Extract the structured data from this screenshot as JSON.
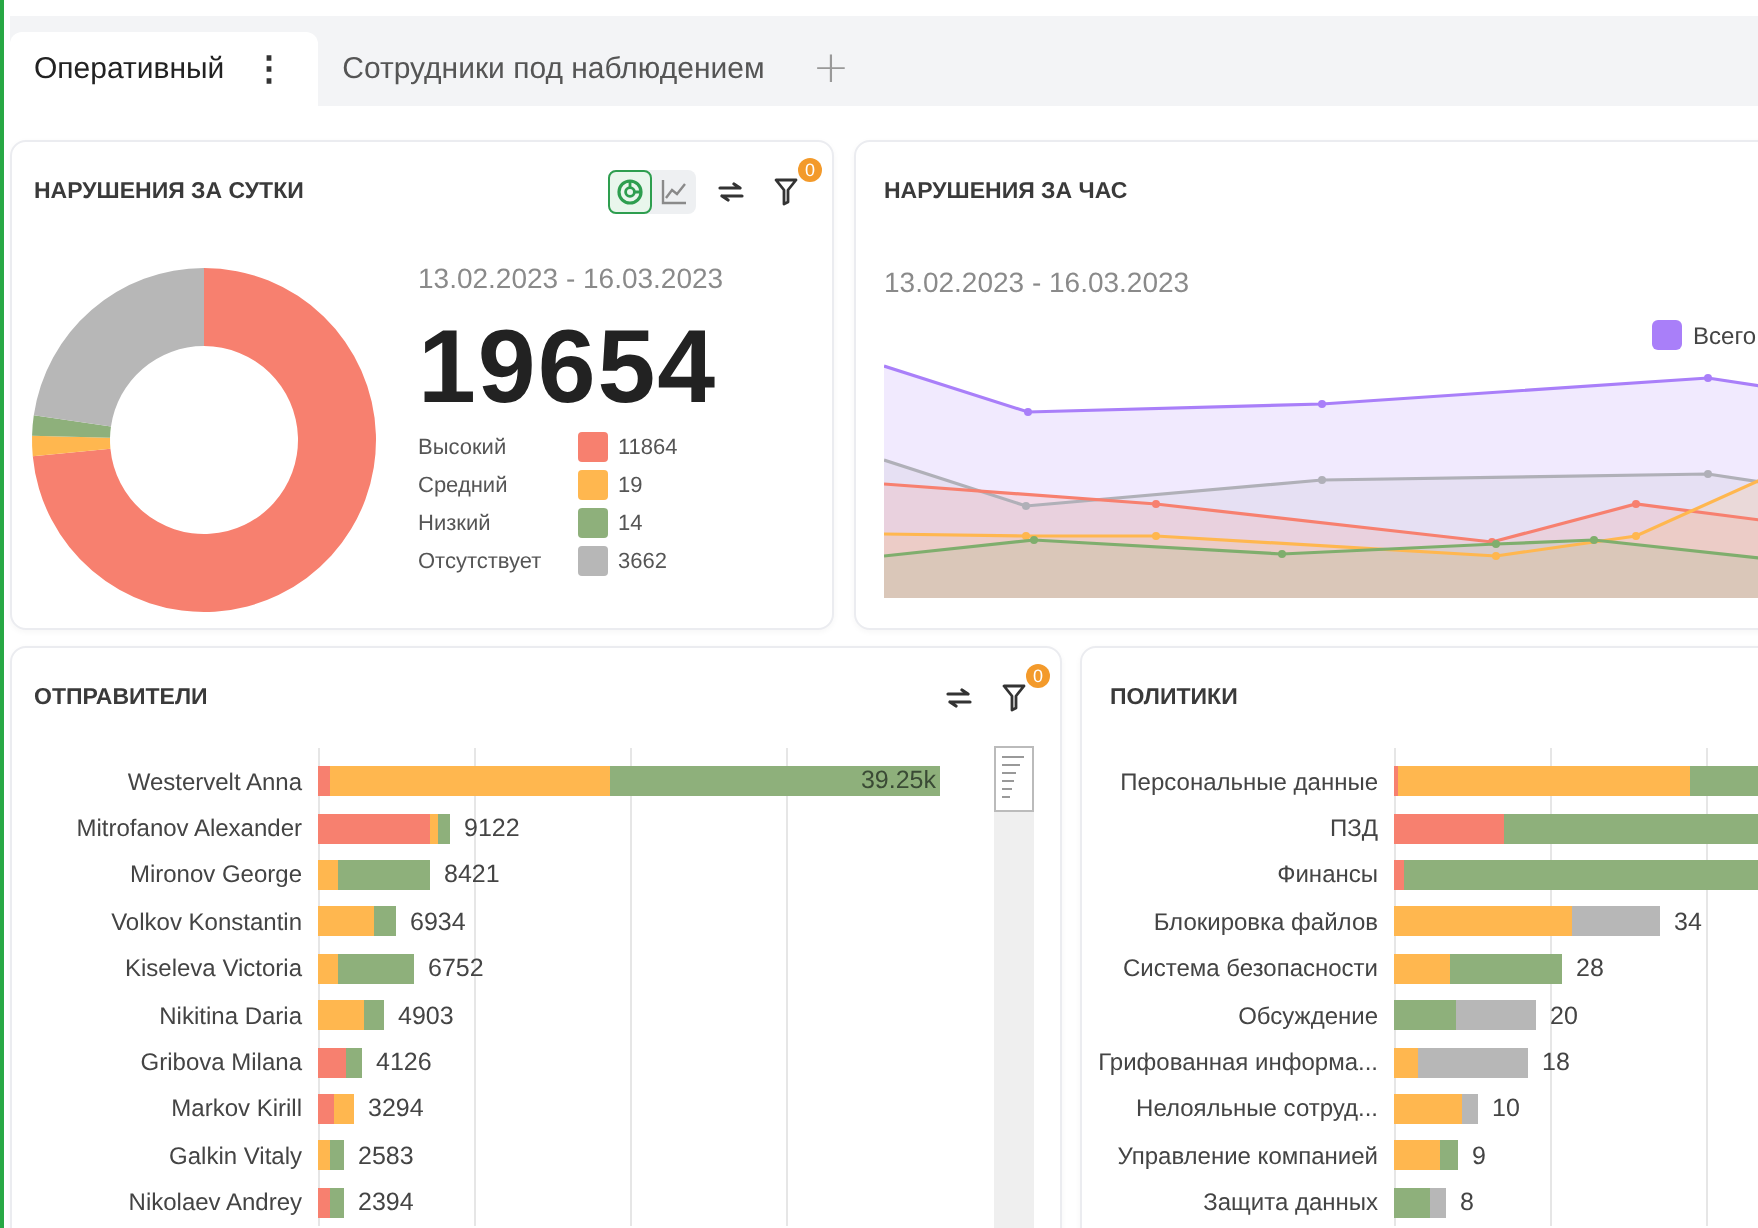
{
  "tabs": [
    {
      "label": "Оперативный",
      "menu": "⋮",
      "selected": true
    },
    {
      "label": "Сотрудники под наблюдением",
      "selected": false
    }
  ],
  "add_tab": "+",
  "daily": {
    "title": "НАРУШЕНИЯ ЗА СУТКИ",
    "view_toggles": [
      {
        "kind": "donut",
        "selected": true
      },
      {
        "kind": "line",
        "selected": false
      }
    ],
    "filter_badge": "0",
    "date_range": "13.02.2023 - 16.03.2023",
    "total": "19654",
    "legend": [
      {
        "label": "Высокий",
        "value": "11864",
        "color": "#f7806f"
      },
      {
        "label": "Средний",
        "value": "19",
        "color": "#ffb74f"
      },
      {
        "label": "Низкий",
        "value": "14",
        "color": "#8eb07b"
      },
      {
        "label": "Отсутствует",
        "value": "3662",
        "color": "#b7b7b7"
      }
    ]
  },
  "hourly": {
    "title": "НАРУШЕНИЯ ЗА ЧАС",
    "date_range": "13.02.2023 - 16.03.2023",
    "legend": [
      {
        "label": "Всего",
        "color": "#a97ff9"
      }
    ]
  },
  "senders": {
    "title": "ОТПРАВИТЕЛИ",
    "filter_badge": "0",
    "rows": [
      {
        "name": "Westervelt Anna",
        "value": "39.25k"
      },
      {
        "name": "Mitrofanov Alexander",
        "value": "9122"
      },
      {
        "name": "Mironov George",
        "value": "8421"
      },
      {
        "name": "Volkov Konstantin",
        "value": "6934"
      },
      {
        "name": "Kiseleva Victoria",
        "value": "6752"
      },
      {
        "name": "Nikitina Daria",
        "value": "4903"
      },
      {
        "name": "Gribova Milana",
        "value": "4126"
      },
      {
        "name": "Markov Kirill",
        "value": "3294"
      },
      {
        "name": "Galkin Vitaly",
        "value": "2583"
      },
      {
        "name": "Nikolaev Andrey",
        "value": "2394"
      }
    ]
  },
  "policies": {
    "title": "ПОЛИТИКИ",
    "rows": [
      {
        "name": "Персональные данные"
      },
      {
        "name": "ПЗД"
      },
      {
        "name": "Финансы"
      },
      {
        "name": "Блокировка файлов",
        "value": "34"
      },
      {
        "name": "Система безопасности",
        "value": "28"
      },
      {
        "name": "Обсуждение",
        "value": "20"
      },
      {
        "name": "Грифованная информа...",
        "value": "18"
      },
      {
        "name": "Нелояльные сотруд...",
        "value": "10"
      },
      {
        "name": "Управление компанией",
        "value": "9"
      },
      {
        "name": "Защита данных",
        "value": "8"
      }
    ]
  }
}
